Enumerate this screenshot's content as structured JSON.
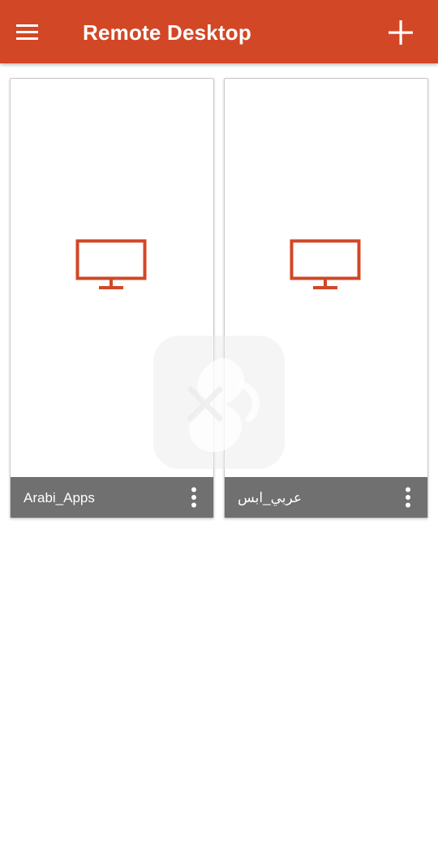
{
  "app_bar": {
    "title": "Remote Desktop",
    "menu_icon": "hamburger-menu-icon",
    "add_icon": "plus-icon",
    "color": "#d24726"
  },
  "connections": [
    {
      "name": "Arabi_Apps",
      "icon": "monitor-icon",
      "menu_icon": "more-vertical-icon"
    },
    {
      "name": "عربي_ابس",
      "icon": "monitor-icon",
      "menu_icon": "more-vertical-icon"
    }
  ],
  "colors": {
    "accent": "#d24726",
    "card_footer": "#707070",
    "background": "#ffffff"
  }
}
